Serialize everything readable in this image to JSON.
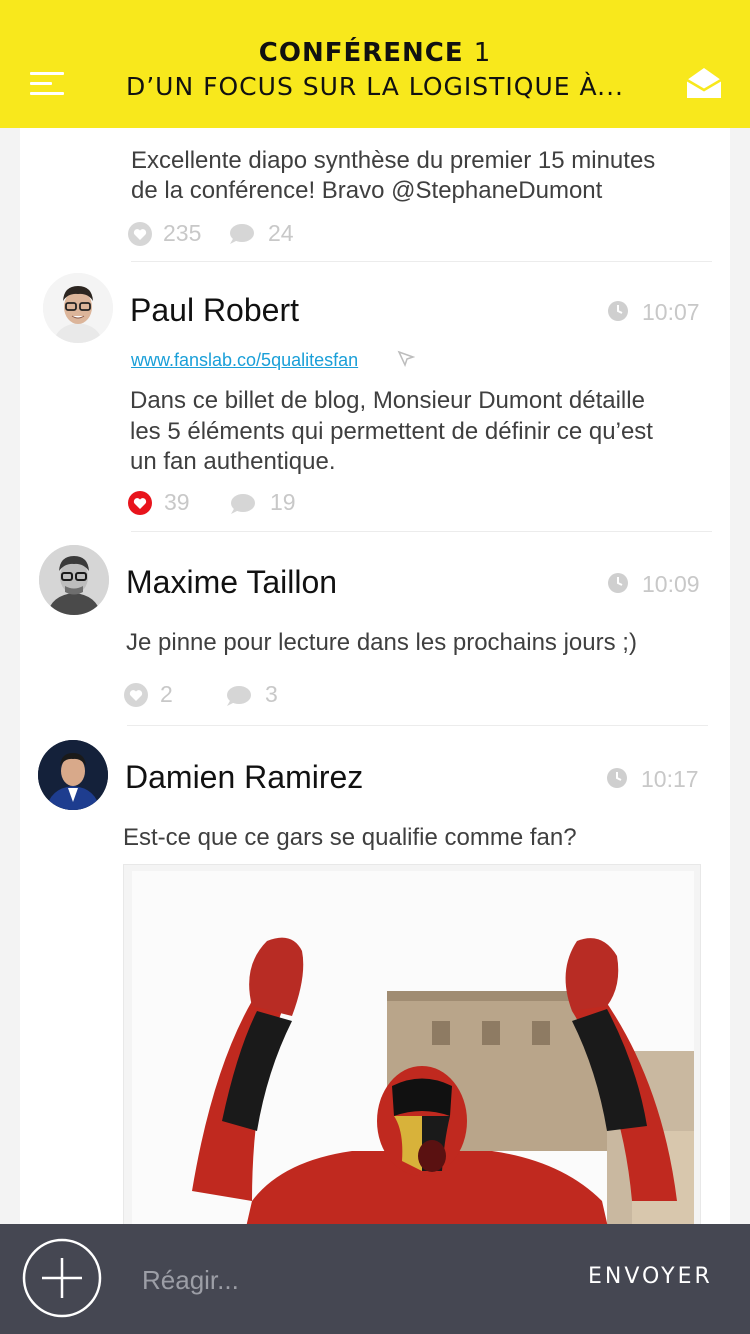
{
  "header": {
    "title_line1": "CONFÉRENCE",
    "title_num": "1",
    "title_line2": "D’UN FOCUS SUR LA LOGISTIQUE À..."
  },
  "posts": [
    {
      "text_lines": [
        "Excellente diapo synthèse du premier 15 minutes",
        "de la conférence! Bravo @StephaneDumont"
      ],
      "likes": "235",
      "comments": "24",
      "liked": false
    },
    {
      "author": "Paul Robert",
      "time": "10:07",
      "link": "www.fanslab.co/5qualitesfan",
      "text_lines": [
        "Dans ce billet de blog, Monsieur Dumont détaille",
        "les 5 éléments qui permettent de définir ce qu’est",
        "un fan authentique."
      ],
      "likes": "39",
      "comments": "19",
      "liked": true
    },
    {
      "author": "Maxime Taillon",
      "time": "10:09",
      "text_lines": [
        "Je pinne pour lecture dans les prochains jours ;)"
      ],
      "likes": "2",
      "comments": "3",
      "liked": false
    },
    {
      "author": "Damien Ramirez",
      "time": "10:17",
      "text_lines": [
        "Est-ce que ce gars se qualifie comme fan?"
      ]
    }
  ],
  "composer": {
    "placeholder": "Réagir...",
    "send_label": "ENVOYER"
  },
  "colors": {
    "header_bg": "#f8e81c",
    "composer_bg": "#454752",
    "link": "#1a9fd8",
    "liked": "#e8141c"
  }
}
